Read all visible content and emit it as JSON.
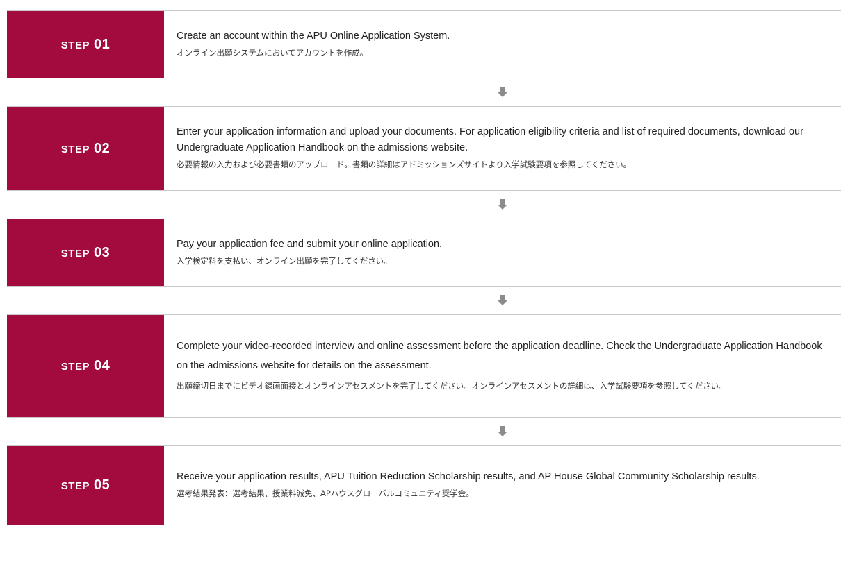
{
  "steps": [
    {
      "word": "STEP",
      "number": "01",
      "en": "Create an account within the APU Online Application System.",
      "ja": "オンライン出願システムにおいてアカウントを作成。"
    },
    {
      "word": "STEP",
      "number": "02",
      "en": "Enter your application information and upload your documents. For application eligibility criteria and list of required documents, download our Undergraduate Application Handbook on the admissions website.",
      "ja": "必要情報の入力および必要書類のアップロード。書類の詳細はアドミッションズサイトより入学試験要項を参照してください。"
    },
    {
      "word": "STEP",
      "number": "03",
      "en": "Pay your application fee and submit your online application.",
      "ja": "入学検定料を支払い、オンライン出願を完了してください。"
    },
    {
      "word": "STEP",
      "number": "04",
      "en": "Complete your video-recorded interview and online assessment before the application deadline. Check the Undergraduate Application Handbook on the admissions website for details on the assessment.",
      "ja": "出願締切日までにビデオ録画面接とオンラインアセスメントを完了してください。オンラインアセスメントの詳細は、入学試験要項を参照してください。"
    },
    {
      "word": "STEP",
      "number": "05",
      "en": "Receive your application results, APU Tuition Reduction Scholarship results, and AP House Global Community Scholarship results.",
      "ja": "選考結果発表：選考結果、授業料減免、APハウスグローバルコミュニティ奨学金。"
    }
  ],
  "arrow_icon": "down-arrow-icon",
  "colors": {
    "accent": "#a30b3e",
    "arrow": "#8c8c8c",
    "border": "#c9c9c9"
  }
}
